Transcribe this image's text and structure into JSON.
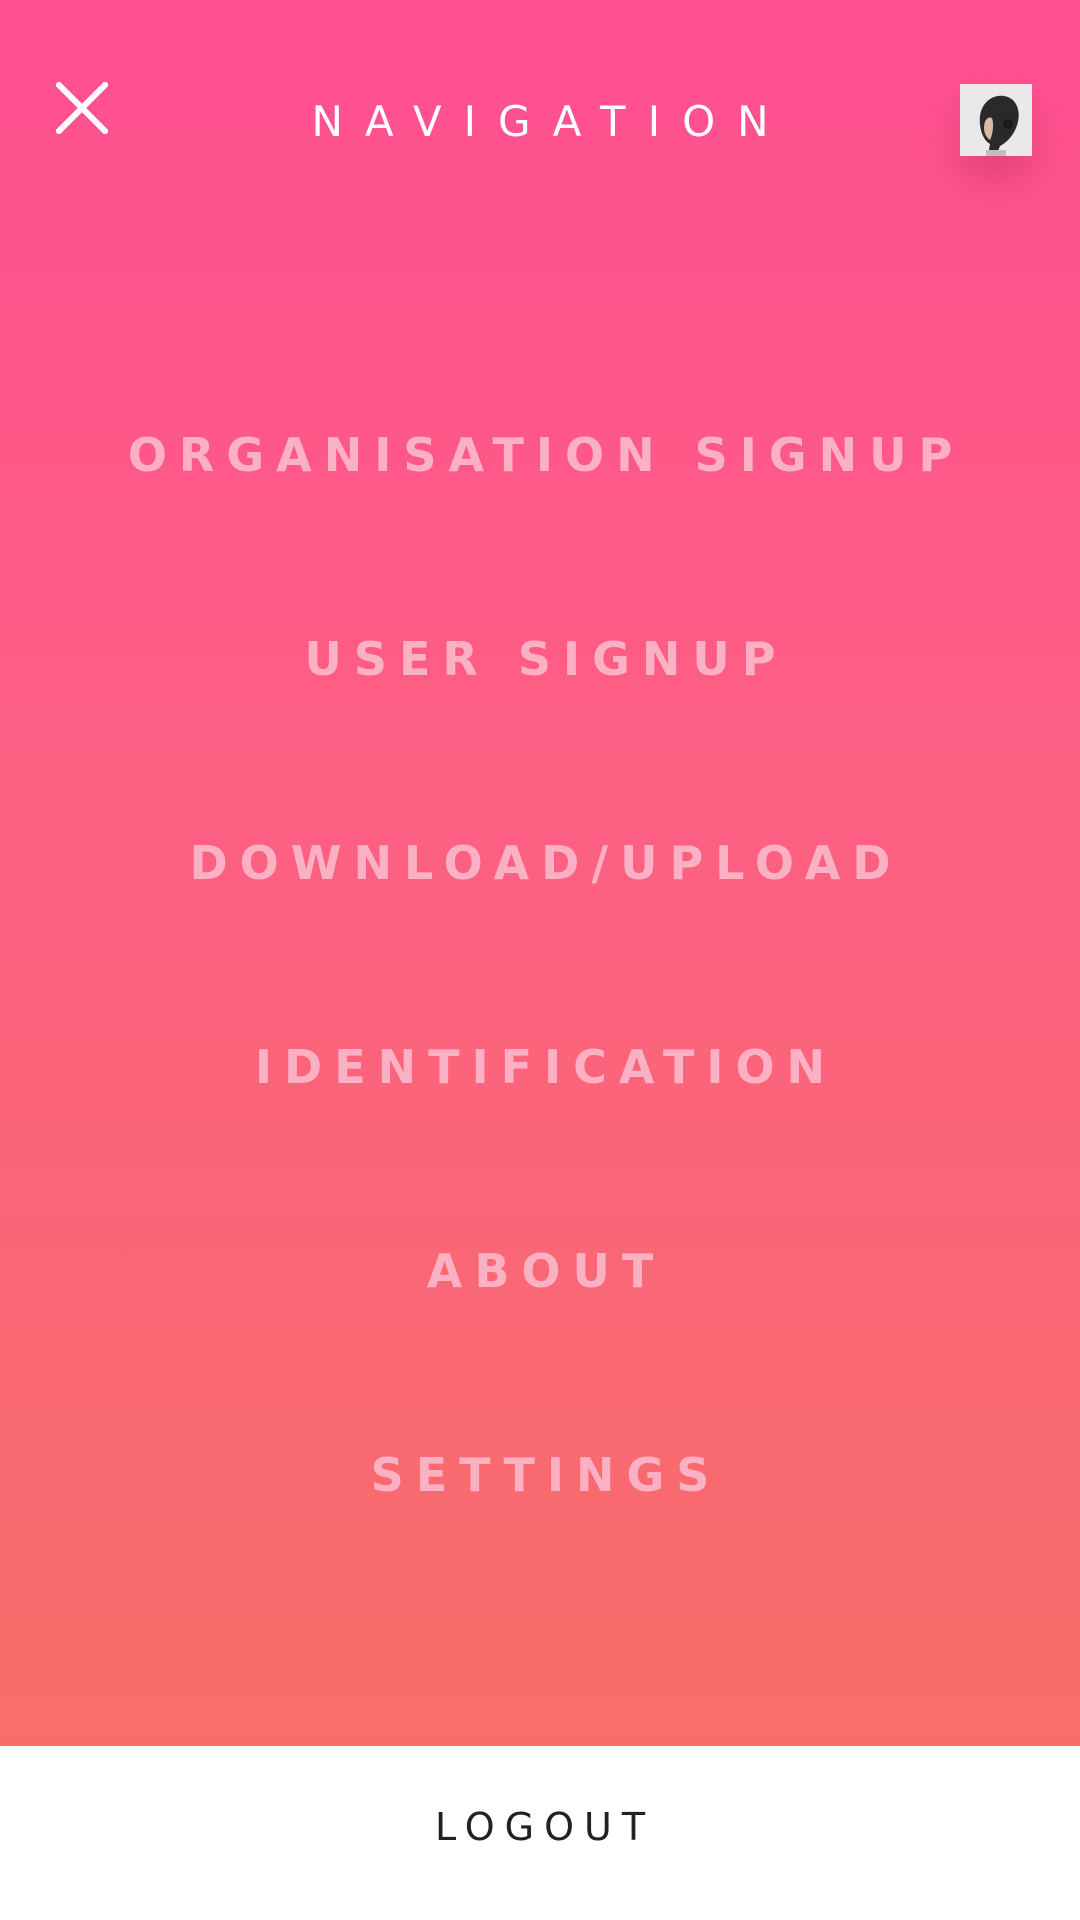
{
  "header": {
    "title": "NAVIGATION",
    "close_icon": "close-icon",
    "avatar": "user-avatar-photo"
  },
  "menu": {
    "items": [
      {
        "label": "ORGANISATION SIGNUP"
      },
      {
        "label": "USER SIGNUP"
      },
      {
        "label": "DOWNLOAD/UPLOAD"
      },
      {
        "label": "IDENTIFICATION"
      },
      {
        "label": "ABOUT"
      },
      {
        "label": "SETTINGS"
      }
    ]
  },
  "footer": {
    "logout_label": "LOGOUT"
  },
  "colors": {
    "gradient_top": "#ff4f91",
    "gradient_bottom": "#f76e69",
    "menu_text": "#fbb0c4",
    "title_text": "#ffffff",
    "footer_bg": "#ffffff",
    "footer_text": "#222222"
  }
}
